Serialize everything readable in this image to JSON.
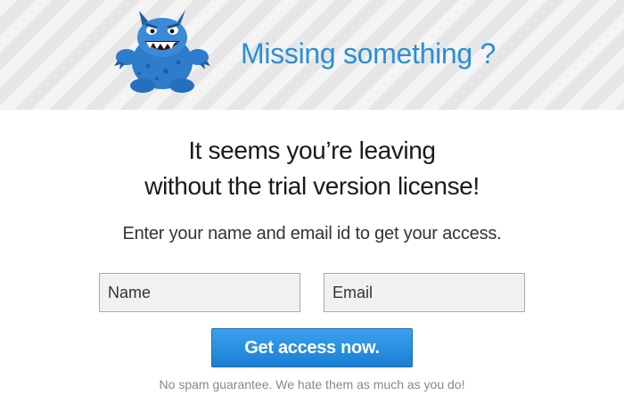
{
  "header": {
    "headline": "Missing something ?",
    "mascot_icon": "blue-monster-icon"
  },
  "main": {
    "title_line1": "It seems you’re leaving",
    "title_line2": "without the trial version license!",
    "subtitle": "Enter your name and email id to get your access."
  },
  "form": {
    "name_placeholder": "Name",
    "email_placeholder": "Email",
    "submit_label": "Get access now.",
    "note": "No spam guarantee. We hate them as much as you do!"
  },
  "colors": {
    "accent": "#2b8fd6",
    "button": "#1a7fd4",
    "mascot": "#2e7ccc"
  }
}
